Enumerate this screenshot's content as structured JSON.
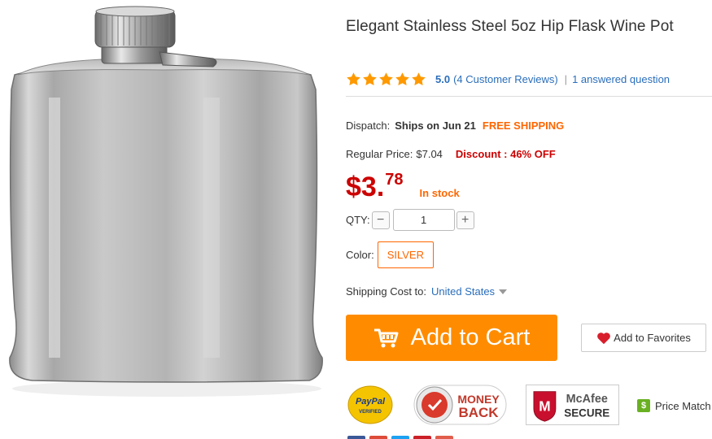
{
  "product": {
    "title": "Elegant Stainless Steel 5oz Hip Flask Wine Pot",
    "image_icon": "hip-flask-image"
  },
  "rating": {
    "stars": 5,
    "score": "5.0",
    "reviews": "(4 Customer Reviews)",
    "separator": "|",
    "answered": "1 answered question",
    "star_color": "#ff9900"
  },
  "dispatch": {
    "label": "Dispatch:",
    "value": "Ships on Jun 21",
    "free_shipping": "FREE SHIPPING"
  },
  "regular_price": {
    "label": "Regular Price:",
    "value": "$7.04",
    "discount": "Discount : 46% OFF"
  },
  "price": {
    "currency": "$",
    "whole": "3",
    "dot": ".",
    "cents": "78",
    "stock": "In stock",
    "color": "#cc0000"
  },
  "quantity": {
    "label": "QTY:",
    "minus": "−",
    "value": "1",
    "plus": "+"
  },
  "color_option": {
    "label": "Color:",
    "selected": "SILVER"
  },
  "shipping": {
    "label": "Shipping Cost to:",
    "country": "United States"
  },
  "actions": {
    "add_to_cart": "Add to Cart",
    "add_to_favorites": "Add to Favorites",
    "cart_color": "#ff8c00"
  },
  "badges": {
    "paypal_top": "PayPal",
    "paypal_bottom": "VERIFIED",
    "money_back_top": "MONEY",
    "money_back_bottom": "BACK",
    "mcafee_top": "McAfee",
    "mcafee_bottom": "SECURE",
    "price_match_icon": "$",
    "price_match": "Price Match"
  },
  "share": {
    "colors": [
      "#3b5998",
      "#dd4b39",
      "#1da1f2",
      "#cb2027",
      "#e05d4b"
    ]
  }
}
